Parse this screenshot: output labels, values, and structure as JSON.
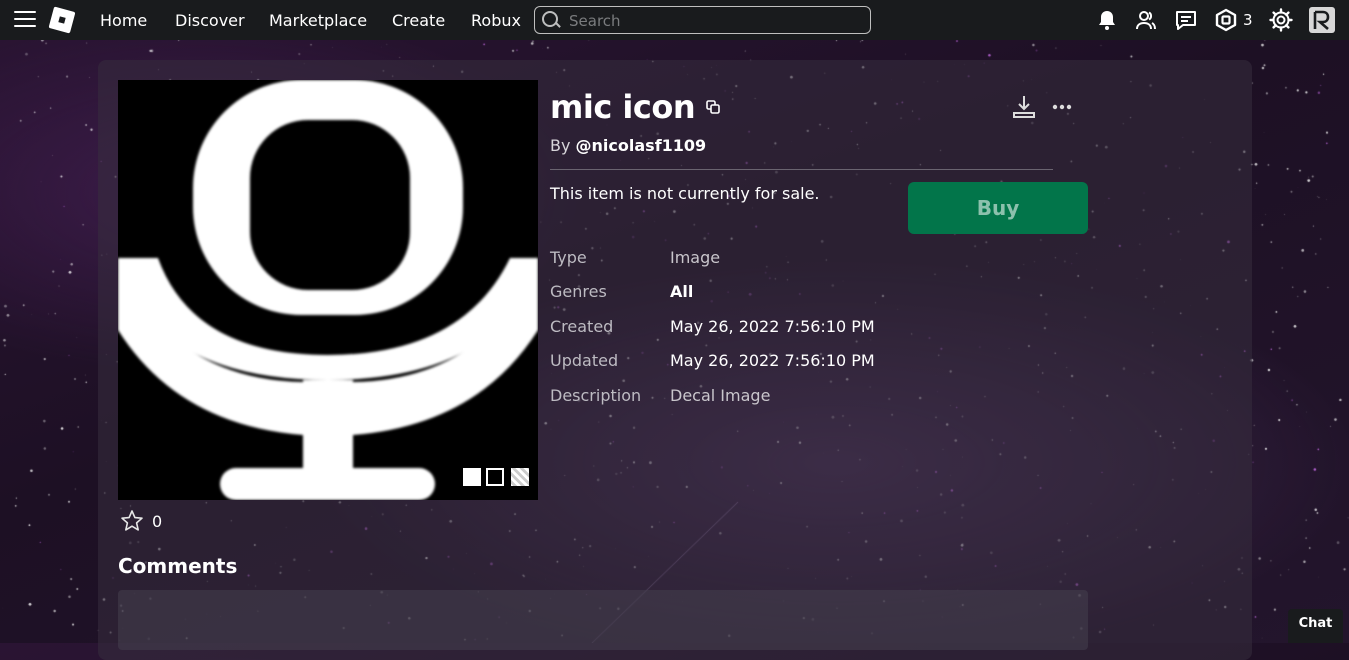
{
  "nav": {
    "links": [
      "Home",
      "Discover",
      "Marketplace",
      "Create",
      "Robux"
    ],
    "search_placeholder": "Search",
    "robux_count": "3"
  },
  "item": {
    "title": "mic icon",
    "by_prefix": "By ",
    "creator": "@nicolasf1109",
    "sale_status": "This item is not currently for sale.",
    "buy_label": "Buy",
    "details": [
      {
        "label": "Type",
        "value": "Image"
      },
      {
        "label": "Genres",
        "value": "All"
      },
      {
        "label": "Created",
        "value": "May 26, 2022 7:56:10 PM"
      },
      {
        "label": "Updated",
        "value": "May 26, 2022 7:56:10 PM"
      },
      {
        "label": "Description",
        "value": "Decal Image"
      }
    ],
    "favorites": "0"
  },
  "comments_heading": "Comments",
  "chat_label": "Chat",
  "colors": {
    "topbar": "#191b1d",
    "buy_button": "#02754a",
    "page_bg": "#1d1024"
  }
}
